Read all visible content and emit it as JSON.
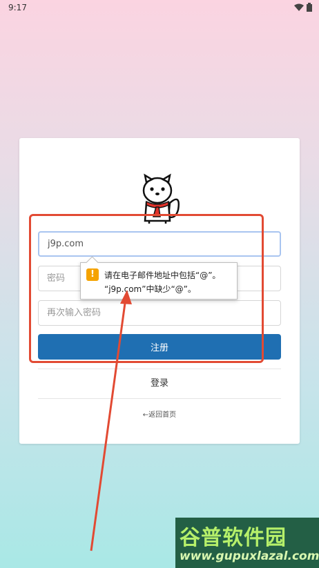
{
  "status_bar": {
    "time": "9:17"
  },
  "form": {
    "email_value": "j9p.com",
    "password_placeholder": "密码",
    "confirm_placeholder": "再次输入密码",
    "register_label": "注册",
    "login_label": "登录",
    "back_label": "←返回首页"
  },
  "tooltip": {
    "icon_glyph": "!",
    "line1": "请在电子邮件地址中包括“@”。",
    "line2": "“j9p.com”中缺少“@”。"
  },
  "watermark": {
    "brand": "谷普软件园",
    "url": "www.gupuxlazal.com"
  },
  "colors": {
    "primary_button": "#1f6fb2",
    "annotation": "#e24a33",
    "warning": "#f5a300"
  }
}
